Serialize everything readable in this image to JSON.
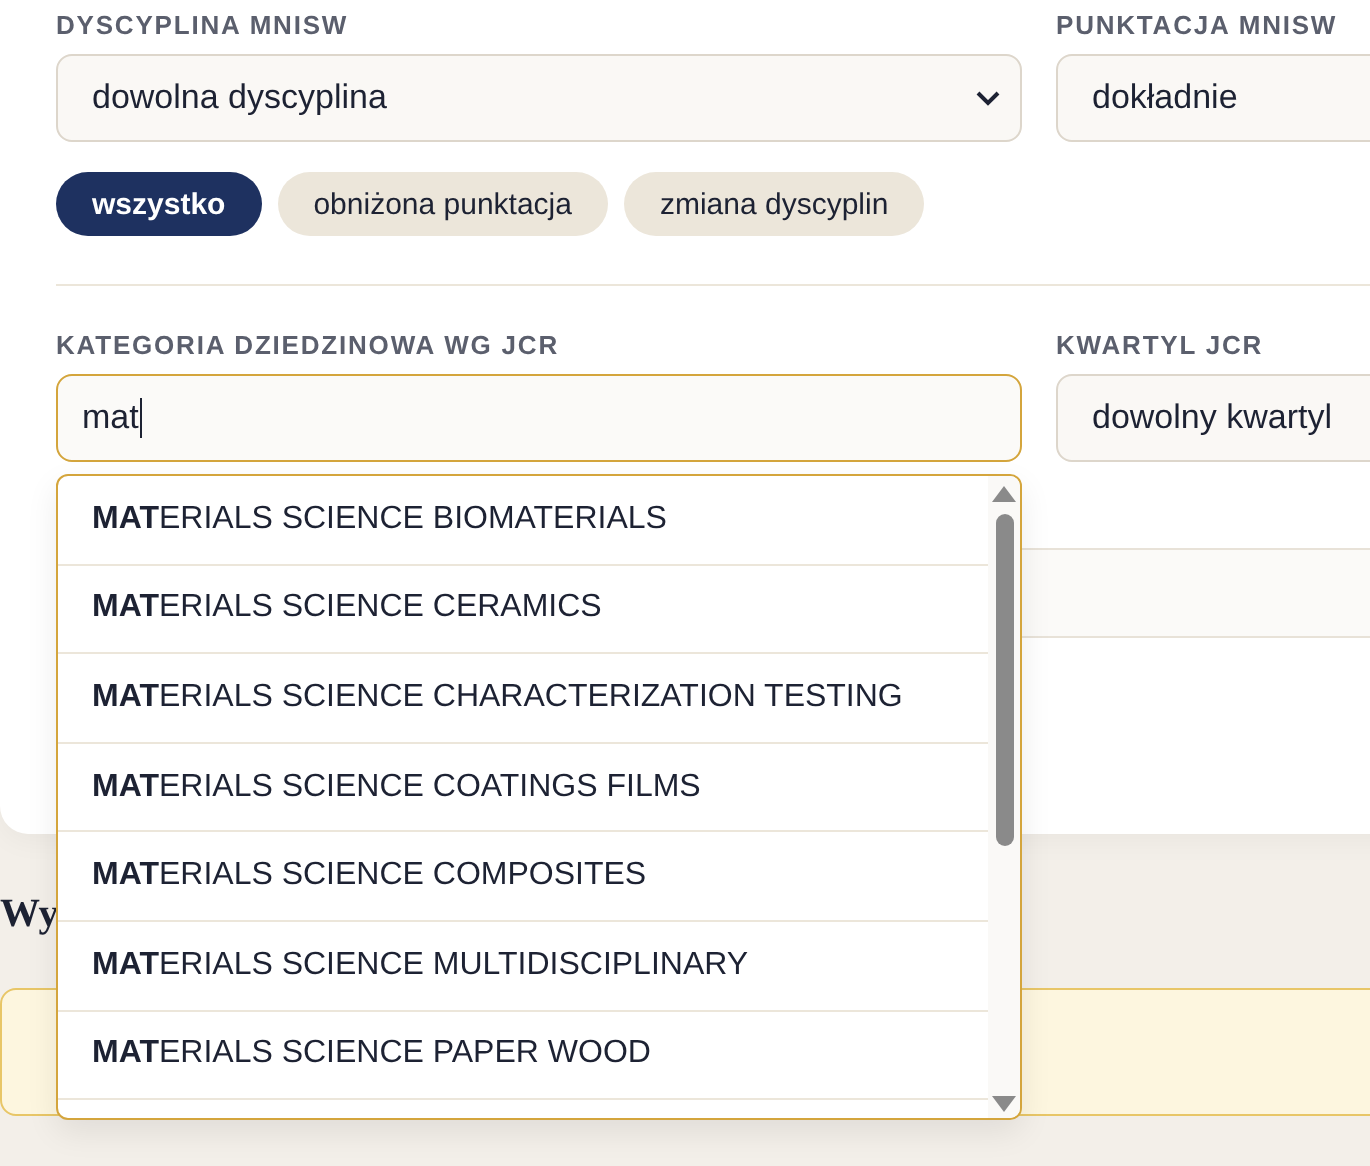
{
  "discipline": {
    "label": "DYSCYPLINA MNISW",
    "value": "dowolna dyscyplina"
  },
  "scoring": {
    "label": "PUNKTACJA MNISW",
    "value": "dokładnie"
  },
  "chips": [
    {
      "label": "wszystko",
      "selected": true
    },
    {
      "label": "obniżona punktacja",
      "selected": false
    },
    {
      "label": "zmiana dyscyplin",
      "selected": false
    }
  ],
  "category": {
    "label": "KATEGORIA DZIEDZINOWA WG JCR",
    "value": "mat"
  },
  "quartile": {
    "label": "KWARTYL JCR",
    "value": "dowolny kwartyl"
  },
  "suggestions": [
    "**MAT**ERIALS SCIENCE BIOMATERIALS",
    "**MAT**ERIALS SCIENCE CERAMICS",
    "**MAT**ERIALS SCIENCE CHARACTERIZATION TESTING",
    "**MAT**ERIALS SCIENCE COATINGS FILMS",
    "**MAT**ERIALS SCIENCE COMPOSITES",
    "**MAT**ERIALS SCIENCE MULTIDISCIPLINARY",
    "**MAT**ERIALS SCIENCE PAPER WOOD"
  ],
  "results_heading": "Wy"
}
